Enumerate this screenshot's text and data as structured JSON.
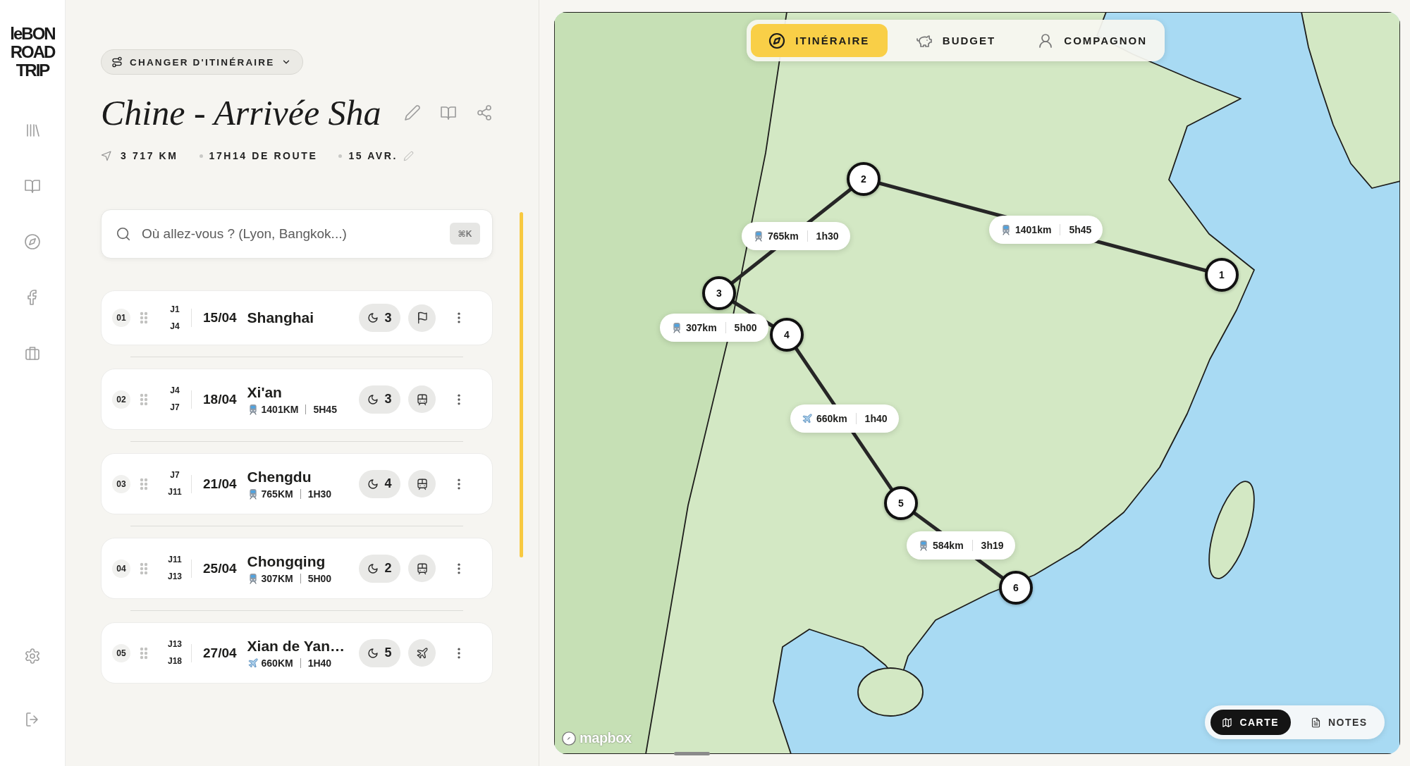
{
  "sidebar": {
    "logo": [
      "leBON",
      "ROAD",
      "TRIP"
    ]
  },
  "header": {
    "switch_button": "CHANGER D'ITINÉRAIRE",
    "title": "Chine - Arrivée Sha",
    "stats": [
      {
        "kind": "distance",
        "text": "3 717 KM"
      },
      {
        "kind": "duration",
        "text": "17H14 DE ROUTE"
      },
      {
        "kind": "date",
        "text": "15 AVR."
      }
    ]
  },
  "search": {
    "placeholder": "Où allez-vous ? (Lyon, Bangkok...)",
    "shortcut": "⌘K"
  },
  "stops": [
    {
      "number": "01",
      "day_start": "J1",
      "day_end": "J4",
      "date": "15/04",
      "name": "Shanghai",
      "nights": "3",
      "kind": "start"
    },
    {
      "number": "02",
      "day_start": "J4",
      "day_end": "J7",
      "date": "18/04",
      "name": "Xi'an",
      "kind": "train",
      "distance": "1401KM",
      "duration": "5H45",
      "nights": "3"
    },
    {
      "number": "03",
      "day_start": "J7",
      "day_end": "J11",
      "date": "21/04",
      "name": "Chengdu",
      "kind": "train",
      "distance": "765KM",
      "duration": "1H30",
      "nights": "4"
    },
    {
      "number": "04",
      "day_start": "J11",
      "day_end": "J13",
      "date": "25/04",
      "name": "Chongqing",
      "kind": "train",
      "distance": "307KM",
      "duration": "5H00",
      "nights": "2"
    },
    {
      "number": "05",
      "day_start": "J13",
      "day_end": "J18",
      "date": "27/04",
      "name": "Xian de Yan…",
      "kind": "plane",
      "distance": "660KM",
      "duration": "1H40",
      "nights": "5"
    }
  ],
  "map": {
    "tabs": [
      {
        "label": "ITINÉRAIRE",
        "selected": true
      },
      {
        "label": "BUDGET",
        "selected": false
      },
      {
        "label": "COMPAGNON",
        "selected": false
      }
    ],
    "markers": [
      "1",
      "2",
      "3",
      "4",
      "5",
      "6"
    ],
    "legs": [
      {
        "kind": "train",
        "distance": "1401km",
        "duration": "5h45"
      },
      {
        "kind": "train",
        "distance": "765km",
        "duration": "1h30"
      },
      {
        "kind": "train",
        "distance": "307km",
        "duration": "5h00"
      },
      {
        "kind": "plane",
        "distance": "660km",
        "duration": "1h40"
      },
      {
        "kind": "train",
        "distance": "584km",
        "duration": "3h19"
      }
    ],
    "view_toggle": [
      {
        "label": "CARTE",
        "selected": true
      },
      {
        "label": "NOTES",
        "selected": false
      }
    ],
    "attribution": "mapbox"
  }
}
